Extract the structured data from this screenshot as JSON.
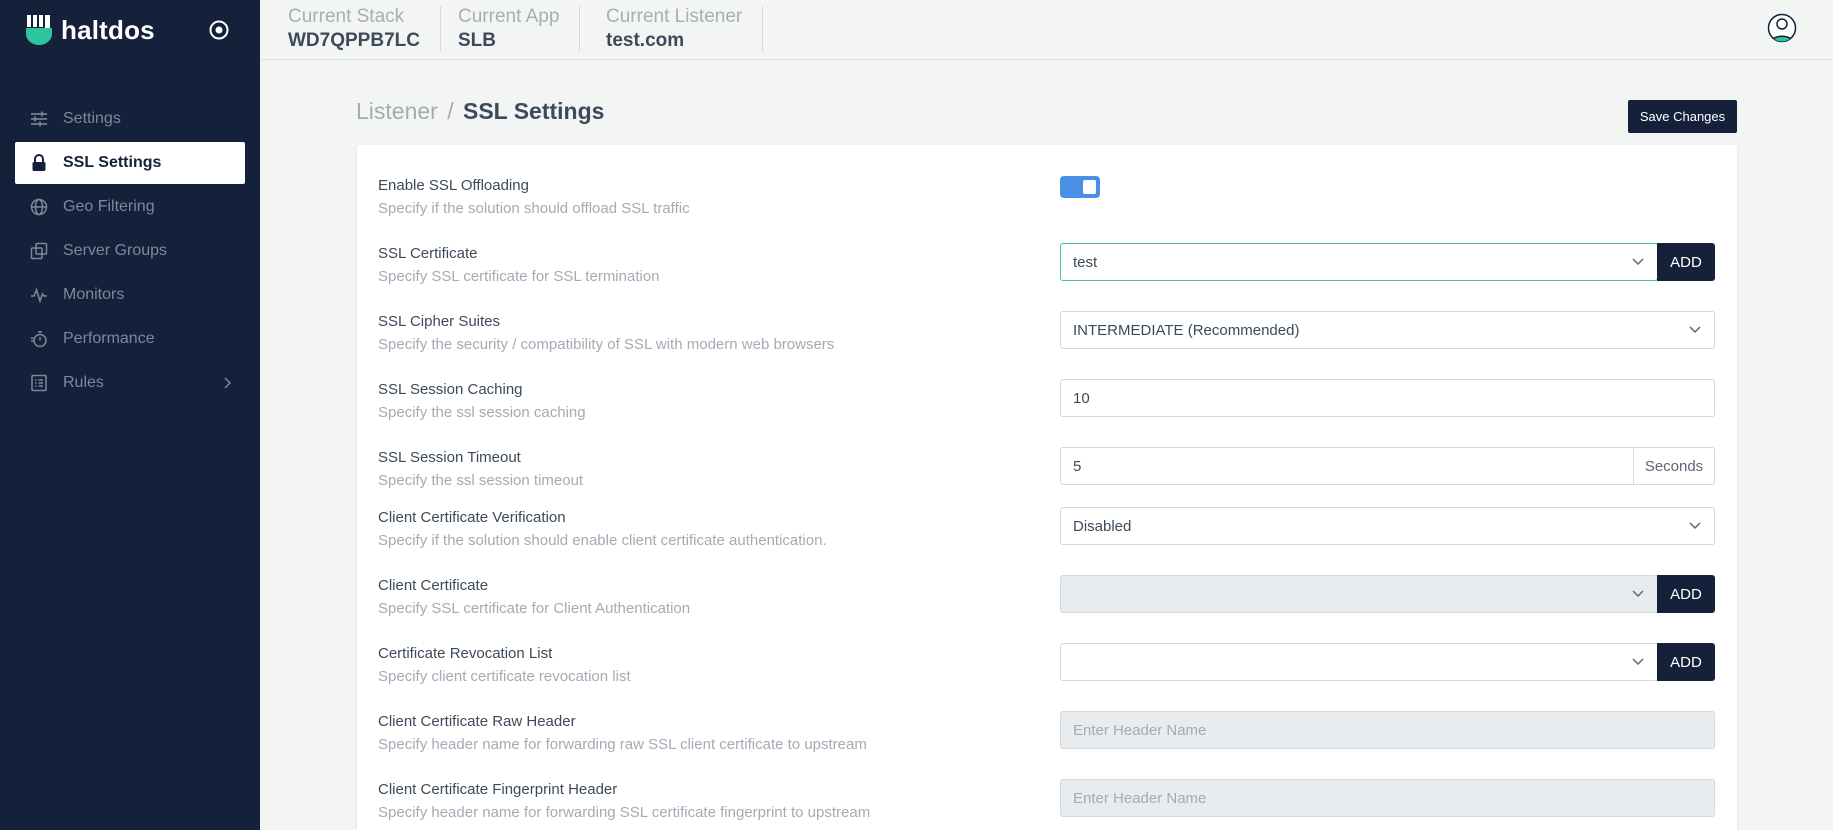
{
  "brand": {
    "name": "haltdos",
    "logo_icon": "haltdos-logo-icon",
    "accent": "#2ec4a0"
  },
  "sidebar": {
    "items": [
      {
        "label": "Settings",
        "icon": "sliders-icon"
      },
      {
        "label": "SSL Settings",
        "icon": "lock-icon",
        "active": true
      },
      {
        "label": "Geo Filtering",
        "icon": "globe-icon"
      },
      {
        "label": "Server Groups",
        "icon": "copy-icon"
      },
      {
        "label": "Monitors",
        "icon": "pulse-icon"
      },
      {
        "label": "Performance",
        "icon": "stopwatch-icon"
      },
      {
        "label": "Rules",
        "icon": "list-icon",
        "has_submenu": true
      }
    ]
  },
  "topbar": {
    "stack_label": "Current Stack",
    "stack_value": "WD7QPPB7LC",
    "app_label": "Current App",
    "app_value": "SLB",
    "listener_label": "Current Listener",
    "listener_value": "test.com"
  },
  "page": {
    "breadcrumb_parent": "Listener",
    "breadcrumb_sep": "/",
    "title": "SSL Settings",
    "save_label": "Save Changes"
  },
  "form": {
    "ssl_offloading": {
      "label": "Enable SSL Offloading",
      "desc": "Specify if the solution should offload SSL traffic",
      "enabled": true
    },
    "ssl_certificate": {
      "label": "SSL Certificate",
      "desc": "Specify SSL certificate for SSL termination",
      "value": "test",
      "add_label": "ADD"
    },
    "cipher_suites": {
      "label": "SSL Cipher Suites",
      "desc": "Specify the security / compatibility of SSL with modern web browsers",
      "value": "INTERMEDIATE (Recommended)"
    },
    "session_caching": {
      "label": "SSL Session Caching",
      "desc": "Specify the ssl session caching",
      "value": "10"
    },
    "session_timeout": {
      "label": "SSL Session Timeout",
      "desc": "Specify the ssl session timeout",
      "value": "5",
      "unit": "Seconds"
    },
    "client_verification": {
      "label": "Client Certificate Verification",
      "desc": "Specify if the solution should enable client certificate authentication.",
      "value": "Disabled"
    },
    "client_certificate": {
      "label": "Client Certificate",
      "desc": "Specify SSL certificate for Client Authentication",
      "value": "",
      "add_label": "ADD"
    },
    "revocation_list": {
      "label": "Certificate Revocation List",
      "desc": "Specify client certificate revocation list",
      "value": "",
      "add_label": "ADD"
    },
    "raw_header": {
      "label": "Client Certificate Raw Header",
      "desc": "Specify header name for forwarding raw SSL client certificate to upstream",
      "placeholder": "Enter Header Name"
    },
    "fingerprint_header": {
      "label": "Client Certificate Fingerprint Header",
      "desc": "Specify header name for forwarding SSL certificate fingerprint to upstream",
      "placeholder": "Enter Header Name"
    }
  }
}
